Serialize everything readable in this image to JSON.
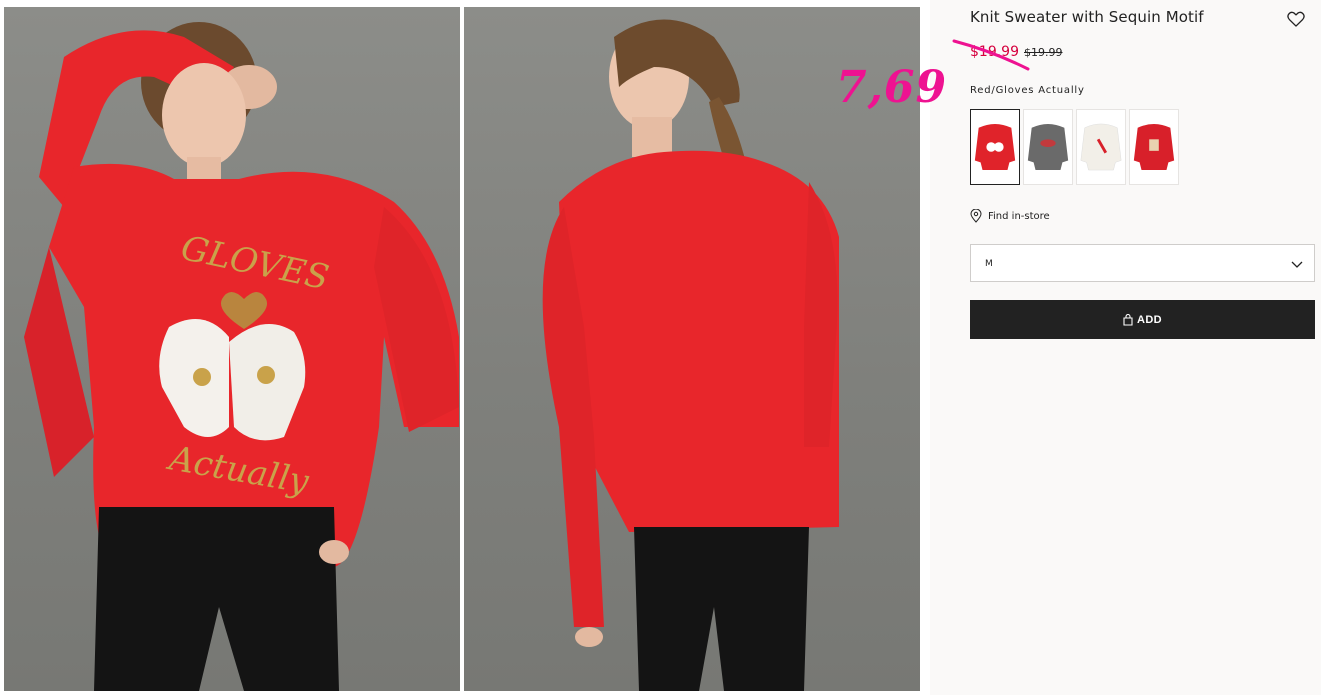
{
  "product": {
    "title": "Knit Sweater with Sequin Motif",
    "sale_price": "$19.99",
    "original_price": "$19.99",
    "handwritten_price": "7,69",
    "color_name": "Red/Gloves Actually"
  },
  "gallery": {
    "front_photo_alt": "Model wearing red sweater front",
    "back_photo_alt": "Model wearing red sweater back"
  },
  "swatches": [
    {
      "name": "Red/Gloves Actually",
      "color": "#e0232a"
    },
    {
      "name": "Dark gray",
      "color": "#6a6a6a"
    },
    {
      "name": "White",
      "color": "#f2efe8"
    },
    {
      "name": "Red",
      "color": "#d8202a"
    }
  ],
  "store": {
    "find_label": "Find in-store"
  },
  "size_select": {
    "selected": "M"
  },
  "cart": {
    "add_label": "ADD"
  },
  "colors": {
    "sale_red": "#d5003e",
    "annotation_pink": "#ee1291",
    "button_black": "#222222",
    "panel_bg": "#faf9f8"
  },
  "icons": {
    "favorite": "heart-icon",
    "store": "location-pin-icon",
    "dropdown": "chevron-down-icon",
    "bag": "shopping-bag-icon"
  }
}
